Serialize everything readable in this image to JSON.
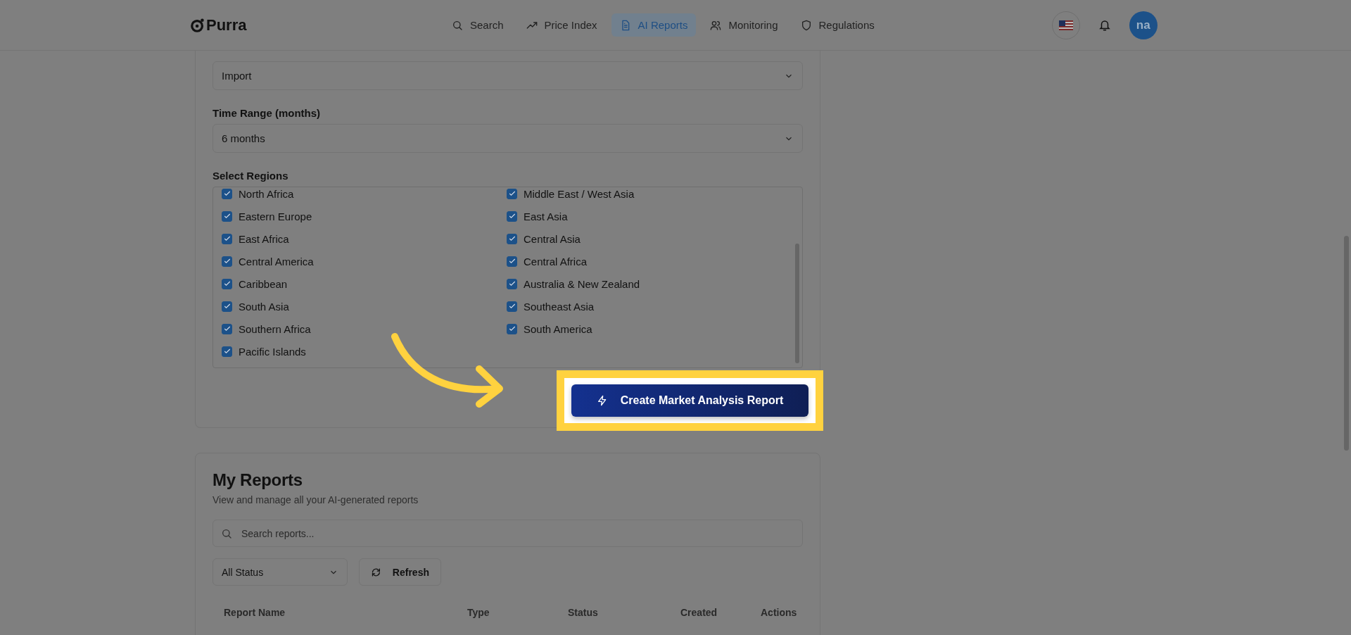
{
  "header": {
    "logo": "Purra",
    "nav": [
      {
        "label": "Search",
        "selected": false
      },
      {
        "label": "Price Index",
        "selected": false
      },
      {
        "label": "AI Reports",
        "selected": true
      },
      {
        "label": "Monitoring",
        "selected": false
      },
      {
        "label": "Regulations",
        "selected": false
      }
    ],
    "avatar": "na"
  },
  "form": {
    "trade_type": {
      "value": "Import"
    },
    "time_range": {
      "label": "Time Range (months)",
      "value": "6 months"
    },
    "regions_label": "Select Regions",
    "regions": [
      {
        "label": "North Africa",
        "checked": true
      },
      {
        "label": "Middle East / West Asia",
        "checked": true
      },
      {
        "label": "Eastern Europe",
        "checked": true
      },
      {
        "label": "East Asia",
        "checked": true
      },
      {
        "label": "East Africa",
        "checked": true
      },
      {
        "label": "Central Asia",
        "checked": true
      },
      {
        "label": "Central America",
        "checked": true
      },
      {
        "label": "Central Africa",
        "checked": true
      },
      {
        "label": "Caribbean",
        "checked": true
      },
      {
        "label": "Australia & New Zealand",
        "checked": true
      },
      {
        "label": "South Asia",
        "checked": true
      },
      {
        "label": "Southeast Asia",
        "checked": true
      },
      {
        "label": "Southern Africa",
        "checked": true
      },
      {
        "label": "South America",
        "checked": true
      },
      {
        "label": "Pacific Islands",
        "checked": true
      }
    ],
    "submit": "Create Market Analysis Report"
  },
  "reports": {
    "title": "My Reports",
    "subtitle": "View and manage all your AI-generated reports",
    "search": {
      "placeholder": "Search reports..."
    },
    "status_filter": "All Status",
    "refresh": "Refresh",
    "columns": [
      "Report Name",
      "Type",
      "Status",
      "Created",
      "Actions"
    ]
  }
}
